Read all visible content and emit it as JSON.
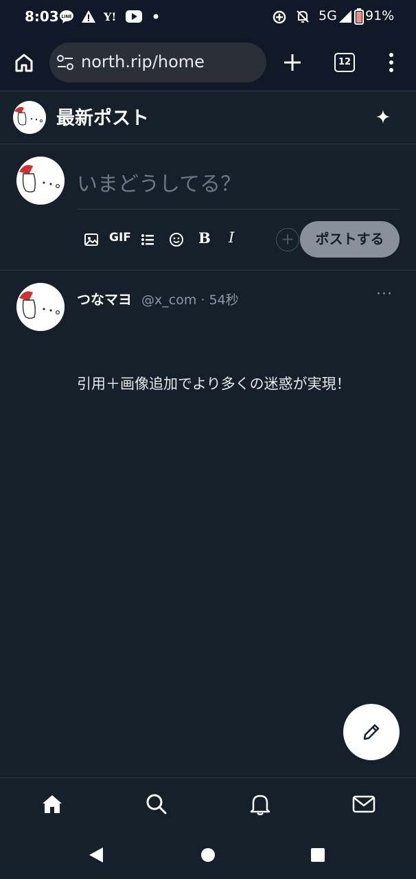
{
  "status_bar": {
    "time": "8:03",
    "left_icons": [
      "line-icon",
      "warning-icon",
      "yahoo-icon",
      "youtube-icon",
      "dot-icon"
    ],
    "network": "5G",
    "battery": "91%"
  },
  "browser": {
    "url": "north.rip/home",
    "tab_count": "12"
  },
  "header": {
    "title": "最新ポスト"
  },
  "composer": {
    "placeholder": "いまどうしてる？",
    "gif_label": "GIF",
    "bold_label": "B",
    "italic_label": "I",
    "post_button_label": "ポストする"
  },
  "post": {
    "display_name": "つなマヨ",
    "handle": "@x_com",
    "separator": "·",
    "time": "54秒",
    "more_label": "···",
    "text": "引用＋画像追加でより多くの迷惑が実現！"
  },
  "bottom_nav": [
    "home-icon",
    "search-icon",
    "bell-icon",
    "mail-icon"
  ],
  "system_nav": [
    "back-icon",
    "home-circle-icon",
    "recents-icon"
  ]
}
